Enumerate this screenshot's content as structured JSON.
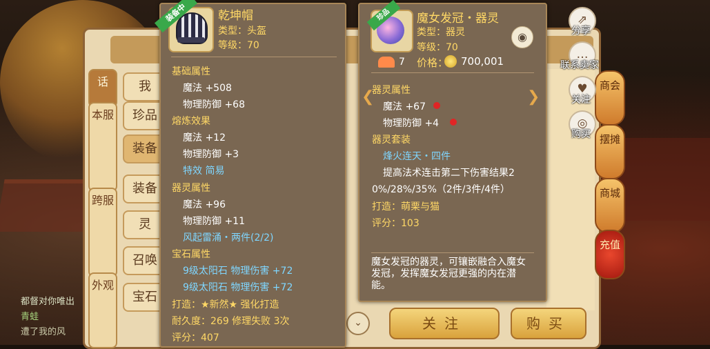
{
  "background": {
    "chat": [
      "都督对你唯出",
      "青蛙",
      "遭了我的风"
    ]
  },
  "trade": {
    "tabs": [
      "话",
      "本服",
      "跨服",
      "外观"
    ],
    "categories": [
      "我",
      "珍品",
      "装备",
      "装备",
      "灵",
      "召唤",
      "宝石"
    ],
    "dropdown_icon": "chevron-down-icon",
    "follow_label": "关注",
    "buy_label": "购买",
    "lanterns": [
      "商会",
      "摆摊",
      "商城",
      "充值"
    ]
  },
  "side_actions": [
    {
      "label": "分享",
      "icon": "share-icon"
    },
    {
      "label": "联系卖家",
      "icon": "chat-icon"
    },
    {
      "label": "关注",
      "icon": "heart-icon"
    },
    {
      "label": "购买",
      "icon": "buy-icon"
    }
  ],
  "item1": {
    "ribbon": "装备中",
    "name": "乾坤帽",
    "type": "类型：头盔",
    "level": "等级：70",
    "sections": {
      "base_title": "基础属性",
      "base": [
        "魔法 +508",
        "物理防御 +68"
      ],
      "refine_title": "熔炼效果",
      "refine": [
        "魔法 +12",
        "物理防御 +3",
        "特效 简易"
      ],
      "spirit_title": "器灵属性",
      "spirit": [
        "魔法 +96",
        "物理防御 +11"
      ],
      "spirit_set": "风起雷涌・两件(2/2)",
      "gem_title": "宝石属性",
      "gems": [
        "9级太阳石 物理伤害 +72",
        "9级太阳石 物理伤害 +72"
      ]
    },
    "craft": "打造：★新然★  强化打造",
    "durability": "耐久度：269 修理失败 3次",
    "score": "评分：407"
  },
  "item2": {
    "ribbon": "珍品",
    "name": "魔女发冠・器灵",
    "type": "类型：器灵",
    "level": "等级：70",
    "likes": "7",
    "price_label": "价格：",
    "price": "700,001",
    "spirit_title": "器灵属性",
    "spirit": [
      "魔法 +67",
      "物理防御 +4"
    ],
    "set_title": "器灵套装",
    "set_name": "烽火连天・四件",
    "set_desc1": "提高法术连击第二下伤害结果2",
    "set_desc2": "0%/28%/35%（2件/3件/4件）",
    "craft": "打造：萌栗与猫",
    "score": "评分：103",
    "description": "魔女发冠的器灵，可镶嵌融合入魔女发冠，发挥魔女发冠更强的内在潜能。"
  }
}
